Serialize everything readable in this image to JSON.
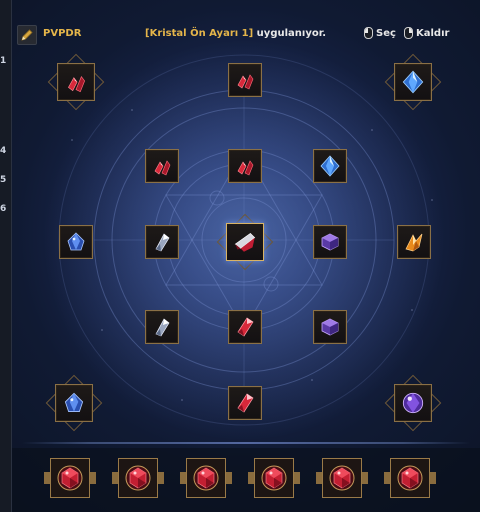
{
  "left_strip": {
    "numbers": [
      "1",
      "4",
      "5",
      "6"
    ]
  },
  "header": {
    "preset_name": "PVPDR",
    "status_highlight": "[Kristal Ön Ayarı 1]",
    "status_rest": " uygulanıyor.",
    "hint_select": "Seç",
    "hint_remove": "Kaldır"
  },
  "colors": {
    "accent_gold": "#e4b54a",
    "frame_gold": "#8a7046",
    "red_crystal": "#d8283a",
    "blue_crystal": "#3f7cd6",
    "purple_crystal": "#7a4fc4",
    "orange_crystal": "#e88a1c"
  },
  "slots": [
    {
      "name": "slot-top-left",
      "icon": "red-shard-pair-icon"
    },
    {
      "name": "slot-top-center",
      "icon": "red-shard-pair-icon"
    },
    {
      "name": "slot-top-right",
      "icon": "blue-crystal-icon"
    },
    {
      "name": "slot-row2-left",
      "icon": "red-shard-pair-icon"
    },
    {
      "name": "slot-row2-center",
      "icon": "red-shard-pair-icon"
    },
    {
      "name": "slot-row2-right",
      "icon": "blue-crystal-icon"
    },
    {
      "name": "slot-mid-far-left",
      "icon": "blue-sapphire-icon"
    },
    {
      "name": "slot-mid-left",
      "icon": "silver-shard-icon"
    },
    {
      "name": "slot-center",
      "icon": "red-silver-shard-icon"
    },
    {
      "name": "slot-mid-right",
      "icon": "purple-hex-icon"
    },
    {
      "name": "slot-mid-far-right",
      "icon": "orange-crystal-icon"
    },
    {
      "name": "slot-row4-left",
      "icon": "silver-shard-icon"
    },
    {
      "name": "slot-row4-center",
      "icon": "red-crystal-icon"
    },
    {
      "name": "slot-row4-right",
      "icon": "purple-hex-icon"
    },
    {
      "name": "slot-bottom-left",
      "icon": "blue-sapphire-icon"
    },
    {
      "name": "slot-bottom-center",
      "icon": "red-crystal-icon"
    },
    {
      "name": "slot-bottom-right",
      "icon": "purple-orb-icon"
    }
  ],
  "bottom_gems": [
    {
      "name": "gem-slot-1",
      "icon": "red-ruby-icon"
    },
    {
      "name": "gem-slot-2",
      "icon": "red-ruby-icon"
    },
    {
      "name": "gem-slot-3",
      "icon": "red-ruby-icon"
    },
    {
      "name": "gem-slot-4",
      "icon": "red-ruby-icon"
    },
    {
      "name": "gem-slot-5",
      "icon": "red-ruby-icon"
    },
    {
      "name": "gem-slot-6",
      "icon": "red-ruby-icon"
    }
  ]
}
